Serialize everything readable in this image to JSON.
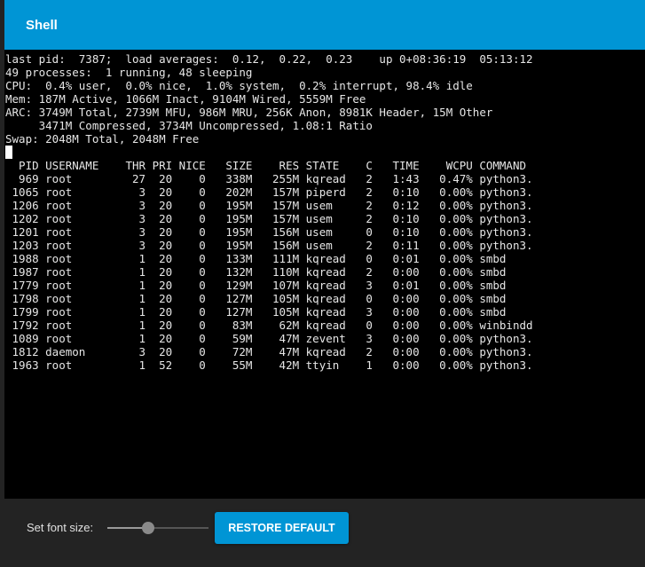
{
  "header": {
    "title": "Shell"
  },
  "terminal": {
    "summary": [
      "last pid:  7387;  load averages:  0.12,  0.22,  0.23    up 0+08:36:19  05:13:12",
      "49 processes:  1 running, 48 sleeping",
      "CPU:  0.4% user,  0.0% nice,  1.0% system,  0.2% interrupt, 98.4% idle",
      "Mem: 187M Active, 1066M Inact, 9104M Wired, 5559M Free",
      "ARC: 3749M Total, 2739M MFU, 986M MRU, 256K Anon, 8981K Header, 15M Other",
      "     3471M Compressed, 3734M Uncompressed, 1.08:1 Ratio",
      "Swap: 2048M Total, 2048M Free"
    ],
    "table_header": "  PID USERNAME    THR PRI NICE   SIZE    RES STATE    C   TIME    WCPU COMMAND",
    "rows": [
      "  969 root         27  20    0   338M   255M kqread   2   1:43   0.47% python3.",
      " 1065 root          3  20    0   202M   157M piperd   2   0:10   0.00% python3.",
      " 1206 root          3  20    0   195M   157M usem     2   0:12   0.00% python3.",
      " 1202 root          3  20    0   195M   157M usem     2   0:10   0.00% python3.",
      " 1201 root          3  20    0   195M   156M usem     0   0:10   0.00% python3.",
      " 1203 root          3  20    0   195M   156M usem     2   0:11   0.00% python3.",
      " 1988 root          1  20    0   133M   111M kqread   0   0:01   0.00% smbd",
      " 1987 root          1  20    0   132M   110M kqread   2   0:00   0.00% smbd",
      " 1779 root          1  20    0   129M   107M kqread   3   0:01   0.00% smbd",
      " 1798 root          1  20    0   127M   105M kqread   0   0:00   0.00% smbd",
      " 1799 root          1  20    0   127M   105M kqread   3   0:00   0.00% smbd",
      " 1792 root          1  20    0    83M    62M kqread   0   0:00   0.00% winbindd",
      " 1089 root          1  20    0    59M    47M zevent   3   0:00   0.00% python3.",
      " 1812 daemon        3  20    0    72M    47M kqread   2   0:00   0.00% python3.",
      " 1963 root          1  52    0    55M    42M ttyin    1   0:00   0.00% python3."
    ]
  },
  "footer": {
    "font_size_label": "Set font size:",
    "font_size_slider_fraction": 0.4,
    "restore_label": "RESTORE DEFAULT"
  },
  "colors": {
    "accent": "#0095d5",
    "terminal_bg": "#000000",
    "terminal_fg": "#e6e6e6",
    "footer_bg": "#232323"
  }
}
